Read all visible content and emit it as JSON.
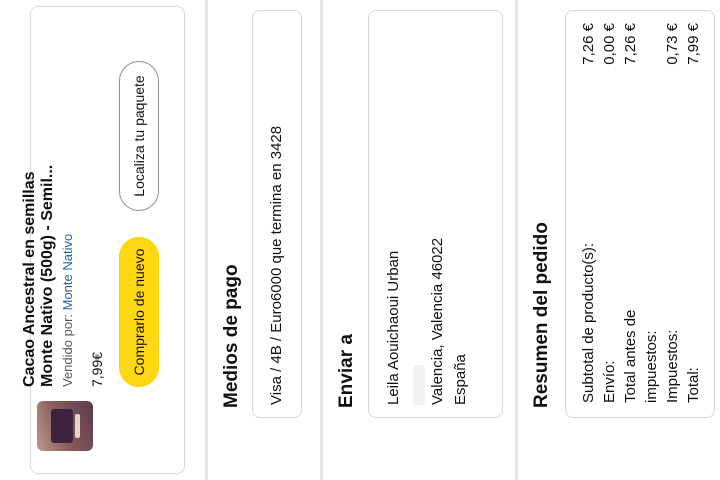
{
  "product": {
    "title_line1": "Cacao Ancestral en semillas",
    "title_line2": "Monte Nativo (500g) - Semil...",
    "seller_prefix": "Vendido por: ",
    "seller_name": "Monte Nativo",
    "price": "7,99€",
    "buy_again_label": "Comprarlo de nuevo",
    "track_label": "Localiza tu paquete"
  },
  "payment": {
    "heading": "Medios de pago",
    "method": "Visa / 4B / Euro6000  que termina en 3428"
  },
  "shipping": {
    "heading": "Enviar a",
    "name": "Leila Aouichaoui Urban",
    "address_line": "Valencia, Valencia 46022",
    "country": "España"
  },
  "summary": {
    "heading": "Resumen del pedido",
    "rows": [
      {
        "label": "Subtotal de producto(s):",
        "value": "7,26 €"
      },
      {
        "label": "Envío:",
        "value": "0,00 €"
      },
      {
        "label": "Total antes de",
        "value": "7,26 €"
      },
      {
        "label": "impuestos:",
        "value": ""
      },
      {
        "label": "Impuestos:",
        "value": "0,73 €"
      },
      {
        "label": "Total:",
        "value": "7,99 €"
      }
    ]
  },
  "colors": {
    "button_yellow": "#ffd814",
    "link_blue": "#2162a1",
    "border": "#d5d9d9"
  }
}
